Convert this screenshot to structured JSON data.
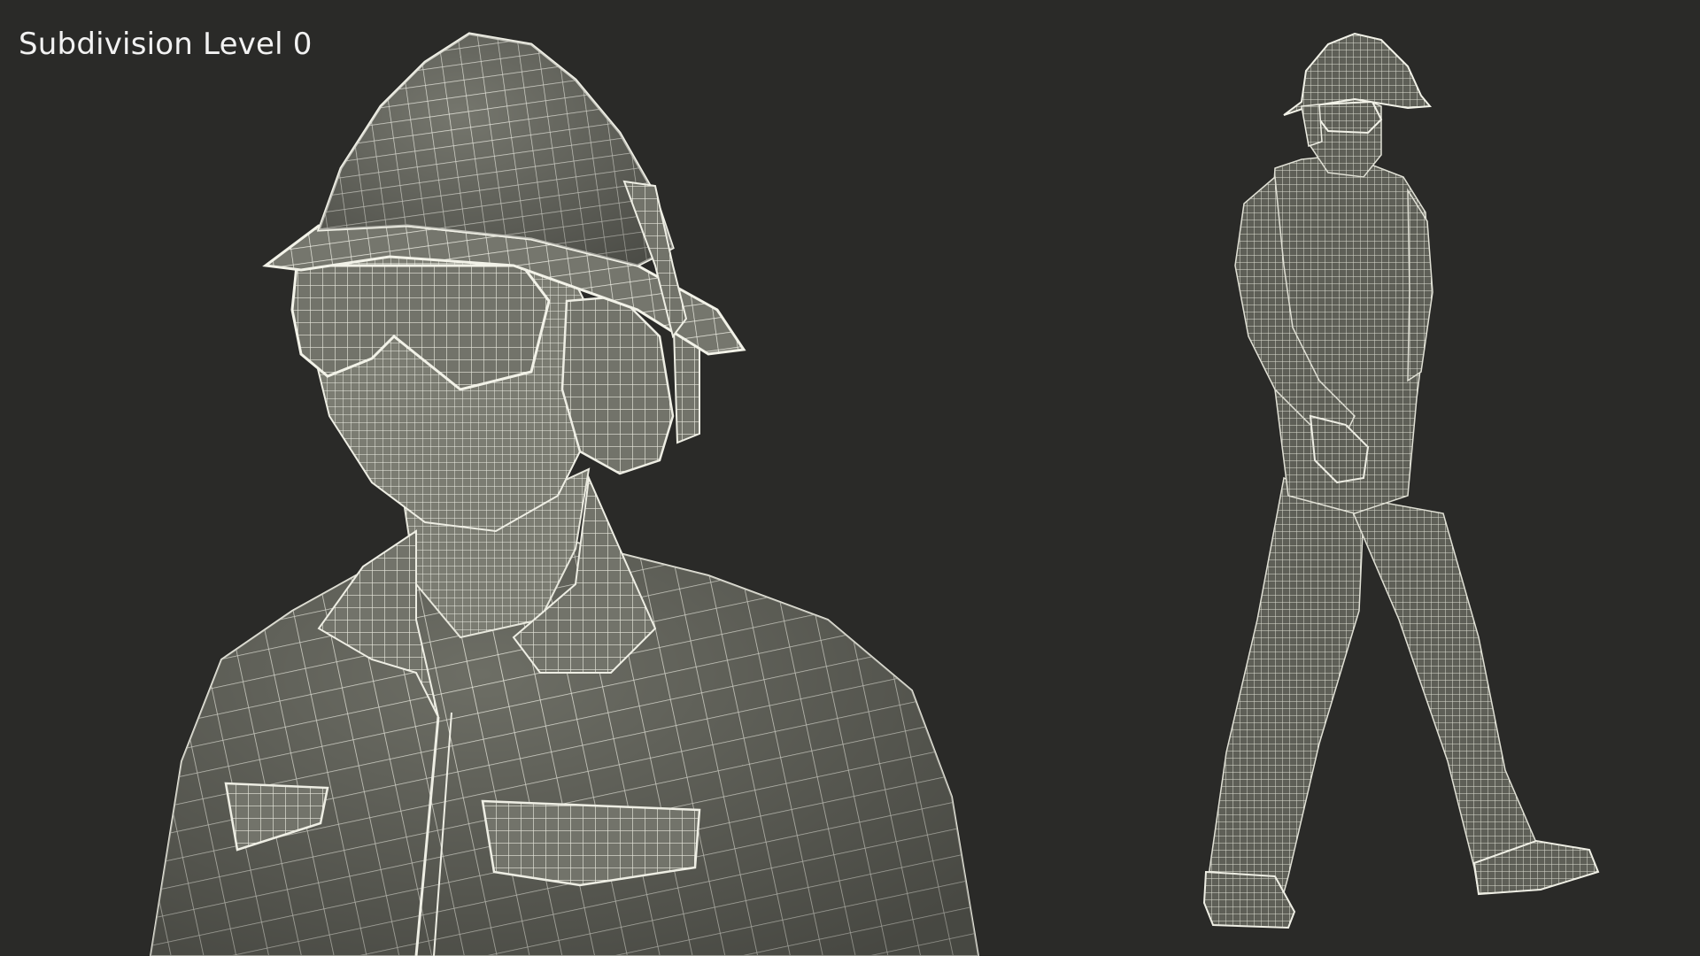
{
  "viewport": {
    "label": "Subdivision Level 0"
  },
  "colors": {
    "background": "#2a2a28",
    "surface": "#6e6f66",
    "surface_light": "#85877d",
    "wire": "#e9e9df",
    "label": "#f2f2f2"
  },
  "scene": {
    "closeup": "worker-bust-wireframe",
    "full_body": "worker-full-body-wireframe"
  }
}
